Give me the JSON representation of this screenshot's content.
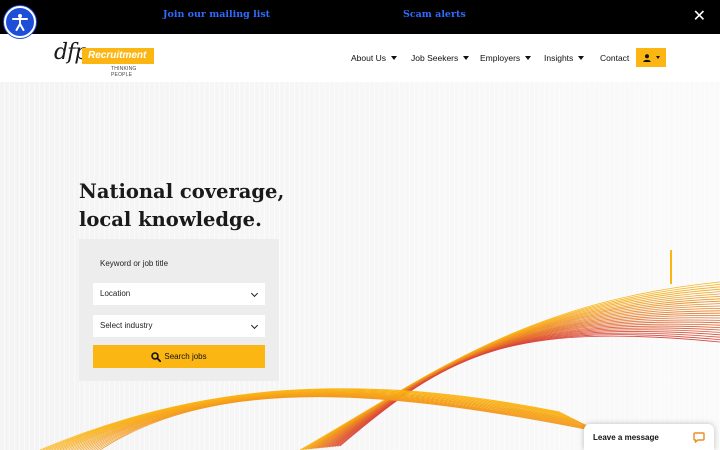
{
  "topbar": {
    "mailing_link": "Join our mailing list",
    "scam_link": "Scam alerts"
  },
  "logo": {
    "mark": "dfp",
    "word": "Recruitment",
    "tagline": "THINKING PEOPLE"
  },
  "nav": {
    "items": [
      {
        "label": "About Us",
        "has_dropdown": true
      },
      {
        "label": "Job Seekers",
        "has_dropdown": true
      },
      {
        "label": "Employers",
        "has_dropdown": true
      },
      {
        "label": "Insights",
        "has_dropdown": true
      },
      {
        "label": "Contact",
        "has_dropdown": false
      }
    ],
    "account_icon": "user-icon"
  },
  "hero": {
    "headline_line1": "National coverage,",
    "headline_line2": "local knowledge."
  },
  "search": {
    "keyword_placeholder": "Keyword or job title",
    "location_value": "Location",
    "industry_value": "Select industry",
    "button_label": "Search jobs",
    "button_icon": "search-icon"
  },
  "chat": {
    "label": "Leave a message",
    "icon": "chat-bubble-icon"
  },
  "colors": {
    "brand_yellow": "#fbb614",
    "link_blue": "#2f6bff",
    "a11y_blue": "#1d4ed8",
    "wave_orange": "#f08a24",
    "wave_red": "#d9423a"
  }
}
